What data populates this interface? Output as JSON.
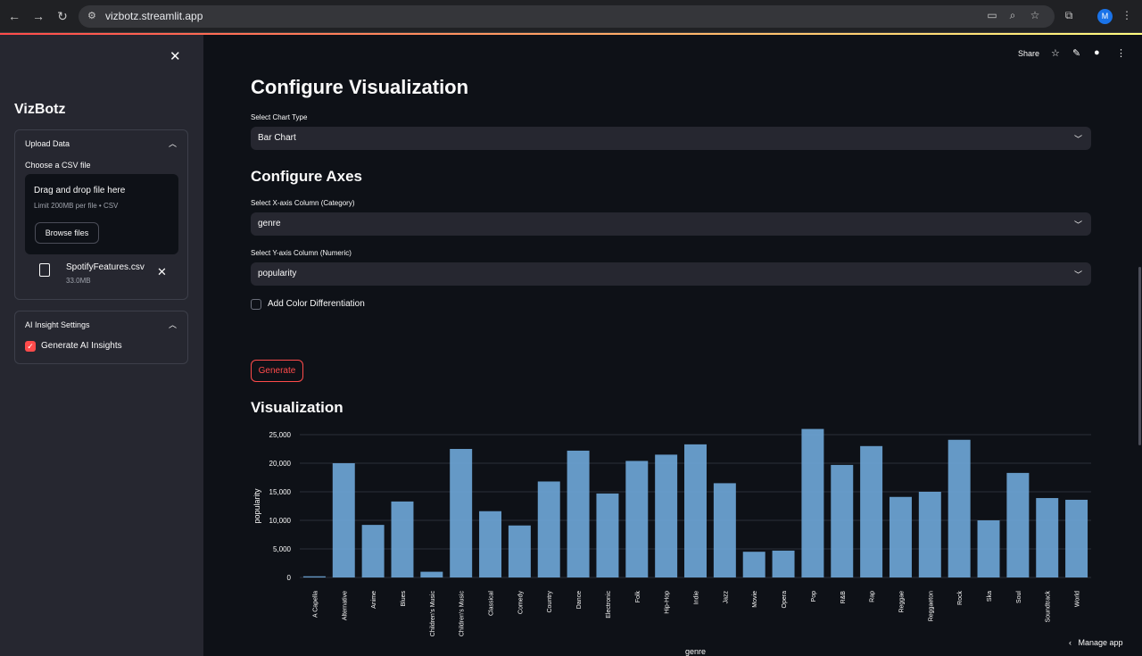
{
  "browser": {
    "url": "vizbotz.streamlit.app",
    "profile_initial": "M"
  },
  "sidebar": {
    "title": "VizBotz",
    "upload": {
      "header": "Upload Data",
      "label": "Choose a CSV file",
      "drop_title": "Drag and drop file here",
      "drop_sub": "Limit 200MB per file • CSV",
      "browse": "Browse files",
      "file_name": "SpotifyFeatures.csv",
      "file_size": "33.0MB"
    },
    "ai": {
      "header": "AI Insight Settings",
      "checkbox": "Generate AI Insights",
      "checked": true
    }
  },
  "toolbar": {
    "share": "Share"
  },
  "main": {
    "title": "Configure Visualization",
    "chart_type_label": "Select Chart Type",
    "chart_type": "Bar Chart",
    "axes_title": "Configure Axes",
    "x_label": "Select X-axis Column (Category)",
    "x_value": "genre",
    "y_label": "Select Y-axis Column (Numeric)",
    "y_value": "popularity",
    "color_diff": "Add Color Differentiation",
    "generate": "Generate",
    "viz_title": "Visualization"
  },
  "manage_app": "Manage app",
  "colors": {
    "accent": "#ff4b4b",
    "bar": "#6fa8d9",
    "bg": "#0e1117",
    "panel": "#262730"
  },
  "chart_data": {
    "type": "bar",
    "xlabel": "genre",
    "ylabel": "popularity",
    "ylim": [
      0,
      25000
    ],
    "yticks": [
      "0",
      "5,000",
      "10,000",
      "15,000",
      "20,000",
      "25,000"
    ],
    "categories": [
      "A Capella",
      "Alternative",
      "Anime",
      "Blues",
      "Children’s Music",
      "Children's Music",
      "Classical",
      "Comedy",
      "Country",
      "Dance",
      "Electronic",
      "Folk",
      "Hip-Hop",
      "Indie",
      "Jazz",
      "Movie",
      "Opera",
      "Pop",
      "R&B",
      "Rap",
      "Reggae",
      "Reggaeton",
      "Rock",
      "Ska",
      "Soul",
      "Soundtrack",
      "World"
    ],
    "values": [
      200,
      20000,
      9200,
      13300,
      1000,
      22500,
      11600,
      9100,
      16800,
      22200,
      14700,
      20400,
      21500,
      23300,
      16500,
      4500,
      4700,
      26000,
      19700,
      23000,
      14100,
      15000,
      24100,
      10000,
      18300,
      13900,
      13600
    ]
  }
}
